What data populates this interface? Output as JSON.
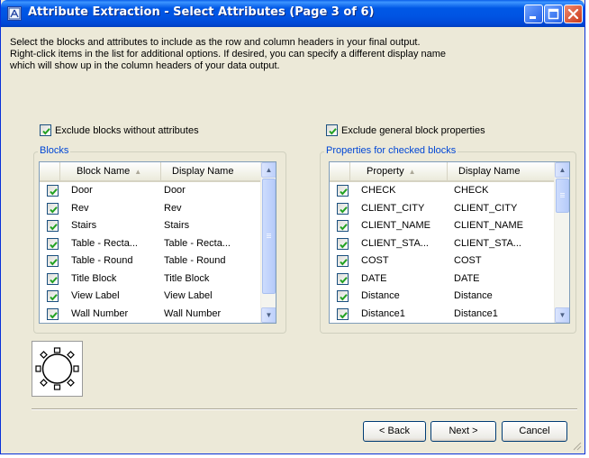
{
  "window": {
    "title": "Attribute Extraction - Select Attributes (Page 3 of 6)",
    "title_icon": "app-icon",
    "controls": [
      "minimize-icon",
      "maximize-icon",
      "close-icon"
    ]
  },
  "description": [
    "Select the blocks and attributes to include as the row and column headers in your final output.",
    "Right-click items in the list for additional options. If desired, you can specify a different display name",
    "which will show up in the column headers of your data output."
  ],
  "exclude_blocks_checkbox": {
    "label": "Exclude blocks without attributes",
    "checked": true
  },
  "exclude_props_checkbox": {
    "label": "Exclude general block properties",
    "checked": true
  },
  "blocks_group": {
    "label": "Blocks",
    "columns": [
      "Block Name",
      "Display Name"
    ],
    "rows": [
      {
        "checked": true,
        "name": "Door",
        "display": "Door"
      },
      {
        "checked": true,
        "name": "Rev",
        "display": "Rev"
      },
      {
        "checked": true,
        "name": "Stairs",
        "display": "Stairs"
      },
      {
        "checked": true,
        "name": "Table - Recta...",
        "display": "Table - Recta..."
      },
      {
        "checked": true,
        "name": "Table - Round",
        "display": "Table - Round"
      },
      {
        "checked": true,
        "name": "Title Block",
        "display": "Title Block"
      },
      {
        "checked": true,
        "name": "View Label",
        "display": "View Label"
      },
      {
        "checked": true,
        "name": "Wall Number",
        "display": "Wall Number"
      }
    ]
  },
  "properties_group": {
    "label": "Properties for checked blocks",
    "columns": [
      "Property",
      "Display Name"
    ],
    "rows": [
      {
        "checked": true,
        "name": "CHECK",
        "display": "CHECK"
      },
      {
        "checked": true,
        "name": "CLIENT_CITY",
        "display": "CLIENT_CITY"
      },
      {
        "checked": true,
        "name": "CLIENT_NAME",
        "display": "CLIENT_NAME"
      },
      {
        "checked": true,
        "name": "CLIENT_STA...",
        "display": "CLIENT_STA..."
      },
      {
        "checked": true,
        "name": "COST",
        "display": "COST"
      },
      {
        "checked": true,
        "name": "DATE",
        "display": "DATE"
      },
      {
        "checked": true,
        "name": "Distance",
        "display": "Distance"
      },
      {
        "checked": true,
        "name": "Distance1",
        "display": "Distance1"
      }
    ]
  },
  "buttons": {
    "back": "< Back",
    "next": "Next >",
    "cancel": "Cancel"
  },
  "colors": {
    "titlebar": "#0054e3",
    "group_label": "#0046d5",
    "dialog_bg": "#ece9d8",
    "check": "#21a121"
  }
}
